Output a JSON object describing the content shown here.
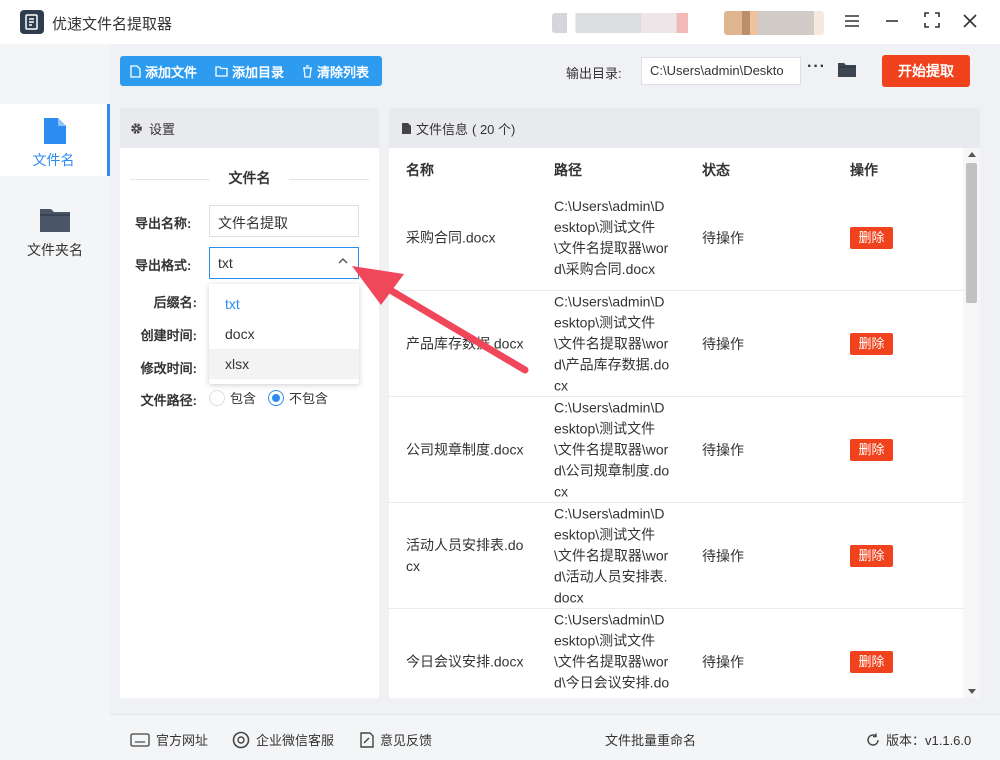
{
  "app": {
    "title": "优速文件名提取器"
  },
  "window": {
    "menu_icon": "menu-icon",
    "min_icon": "minimize-icon",
    "max_icon": "maximize-icon",
    "close_icon": "close-icon"
  },
  "nav": {
    "items": [
      {
        "label": "文件名",
        "icon": "file-icon",
        "active": true
      },
      {
        "label": "文件夹名",
        "icon": "folder-icon",
        "active": false
      }
    ]
  },
  "toolbar": {
    "add_file": "添加文件",
    "add_dir": "添加目录",
    "clear_list": "清除列表",
    "output_label": "输出目录:",
    "output_value": "C:\\Users\\admin\\Deskto",
    "more": "···",
    "start": "开始提取"
  },
  "settings": {
    "header": "设置",
    "section": "文件名",
    "export_name_label": "导出名称:",
    "export_name_value": "文件名提取",
    "export_format_label": "导出格式:",
    "export_format_value": "txt",
    "format_options": [
      "txt",
      "docx",
      "xlsx"
    ],
    "suffix_label": "后缀名:",
    "created_label": "创建时间:",
    "modified_label": "修改时间:",
    "path_label": "文件路径:",
    "path_opt_include": "包含",
    "path_opt_exclude": "不包含"
  },
  "files": {
    "header": "文件信息",
    "count": "( 20 个)",
    "columns": {
      "name": "名称",
      "path": "路径",
      "status": "状态",
      "action": "操作"
    },
    "rows": [
      {
        "name": "采购合同.docx",
        "path": "C:\\Users\\admin\\Desktop\\测试文件\\文件名提取器\\word\\采购合同.docx",
        "status": "待操作",
        "action": "删除"
      },
      {
        "name": "产品库存数据.docx",
        "path": "C:\\Users\\admin\\Desktop\\测试文件\\文件名提取器\\word\\产品库存数据.docx",
        "status": "待操作",
        "action": "删除"
      },
      {
        "name": "公司规章制度.docx",
        "path": "C:\\Users\\admin\\Desktop\\测试文件\\文件名提取器\\word\\公司规章制度.docx",
        "status": "待操作",
        "action": "删除"
      },
      {
        "name": "活动人员安排表.docx",
        "path": "C:\\Users\\admin\\Desktop\\测试文件\\文件名提取器\\word\\活动人员安排表.docx",
        "status": "待操作",
        "action": "删除"
      },
      {
        "name": "今日会议安排.docx",
        "path": "C:\\Users\\admin\\Desktop\\测试文件\\文件名提取器\\word\\今日会议安排.docx",
        "status": "待操作",
        "action": "删除"
      }
    ]
  },
  "footer": {
    "website": "官方网址",
    "wechat": "企业微信客服",
    "feedback": "意见反馈",
    "batch_rename": "文件批量重命名",
    "version": "版本：v1.1.6.0"
  },
  "colors": {
    "accent": "#2d8cf0",
    "toolbar_blue": "#2d9cf0",
    "danger": "#f0421c",
    "arrow": "#f0485a"
  }
}
